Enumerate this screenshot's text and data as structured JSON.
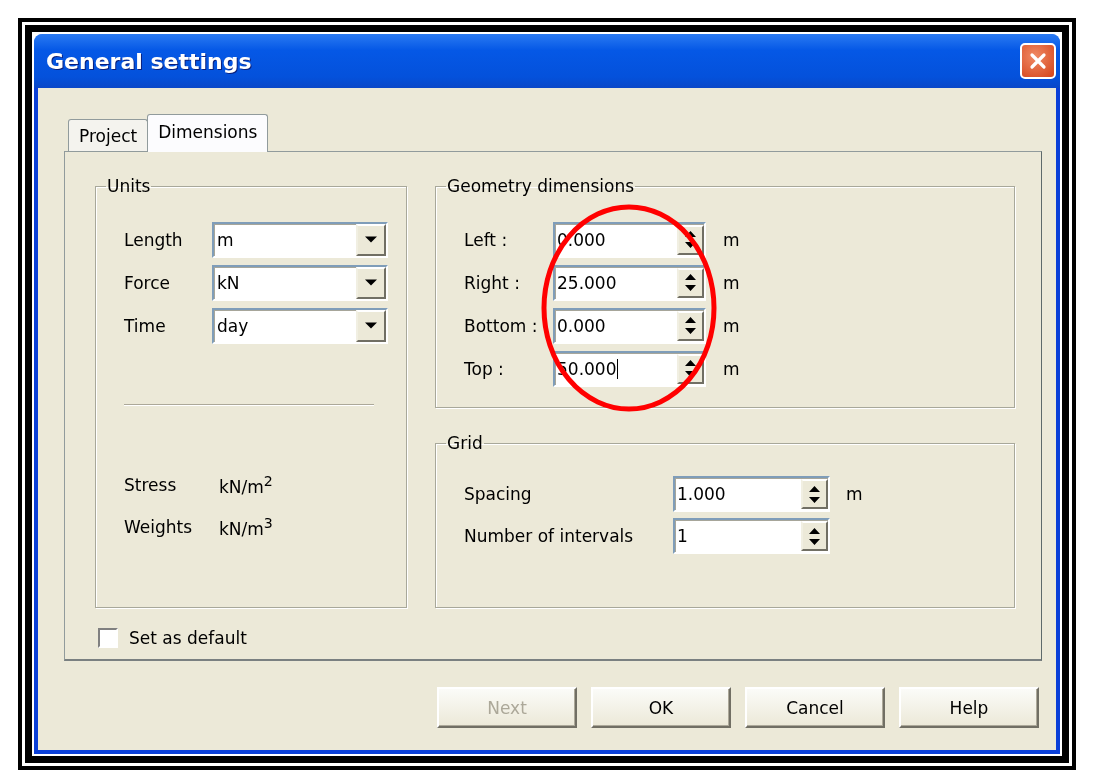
{
  "window": {
    "title": "General settings"
  },
  "tabs": [
    {
      "label": "Project",
      "selected": false
    },
    {
      "label": "Dimensions",
      "selected": true
    }
  ],
  "units": {
    "title": "Units",
    "selects": [
      {
        "label": "Length",
        "value": "m"
      },
      {
        "label": "Force",
        "value": "kN"
      },
      {
        "label": "Time",
        "value": "day"
      }
    ],
    "derived": [
      {
        "label": "Stress",
        "value": "kN/m$^{2}$"
      },
      {
        "label": "Weights",
        "value": "kN/m$^{3}$"
      }
    ]
  },
  "geometry": {
    "title": "Geometry dimensions",
    "fields": [
      {
        "label": "Left :",
        "value": "0.000",
        "unit": "m",
        "focused": false
      },
      {
        "label": "Right :",
        "value": "25.000",
        "unit": "m",
        "focused": false
      },
      {
        "label": "Bottom :",
        "value": "0.000",
        "unit": "m",
        "focused": false
      },
      {
        "label": "Top :",
        "value": "50.000",
        "unit": "m",
        "focused": true
      }
    ]
  },
  "grid": {
    "title": "Grid",
    "fields": [
      {
        "label": "Spacing",
        "value": "1.000",
        "unit": "m",
        "focused": false
      },
      {
        "label": "Number of intervals",
        "value": "1",
        "focused": false
      }
    ]
  },
  "set_as_default": {
    "label": "Set as default",
    "checked": false
  },
  "buttons": [
    {
      "label": "Next",
      "disabled": true
    },
    {
      "label": "OK",
      "disabled": false
    },
    {
      "label": "Cancel",
      "disabled": false
    },
    {
      "label": "Help",
      "disabled": false
    }
  ]
}
